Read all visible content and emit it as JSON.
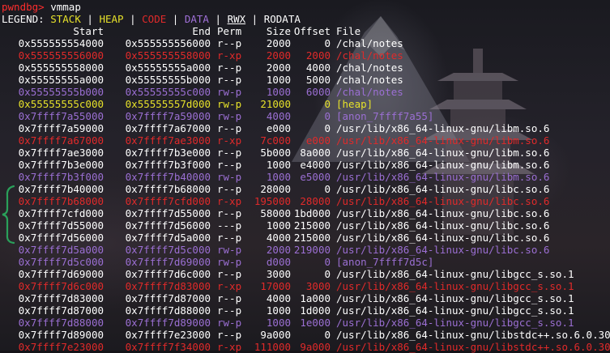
{
  "prompt": {
    "name": "pwndbg>",
    "command": "vmmap"
  },
  "legend": {
    "label": "LEGEND:",
    "stack": "STACK",
    "heap": "HEAP",
    "code": "CODE",
    "data": "DATA",
    "rwx": "RWX",
    "rodata": "RODATA",
    "separator": "|"
  },
  "colors": {
    "code": "#e02a2a",
    "heap_stack": "#e6e12a",
    "data": "#9b6fd3",
    "rodata": "#ffffff",
    "prompt": "#ff2d2d",
    "brace": "#2aa05a"
  },
  "table": {
    "headers": [
      "Start",
      "End",
      "Perm",
      "Size",
      "Offset",
      "File"
    ],
    "rows": [
      {
        "start": "0x555555554000",
        "end": "0x555555556000",
        "perm": "r--p",
        "size": "2000",
        "offset": "0",
        "file": "/chal/notes",
        "kind": "rodata"
      },
      {
        "start": "0x555555556000",
        "end": "0x555555558000",
        "perm": "r-xp",
        "size": "2000",
        "offset": "2000",
        "file": "/chal/notes",
        "kind": "code"
      },
      {
        "start": "0x555555558000",
        "end": "0x55555555a000",
        "perm": "r--p",
        "size": "2000",
        "offset": "4000",
        "file": "/chal/notes",
        "kind": "rodata"
      },
      {
        "start": "0x55555555a000",
        "end": "0x55555555b000",
        "perm": "r--p",
        "size": "1000",
        "offset": "5000",
        "file": "/chal/notes",
        "kind": "rodata"
      },
      {
        "start": "0x55555555b000",
        "end": "0x55555555c000",
        "perm": "rw-p",
        "size": "1000",
        "offset": "6000",
        "file": "/chal/notes",
        "kind": "data"
      },
      {
        "start": "0x55555555c000",
        "end": "0x55555557d000",
        "perm": "rw-p",
        "size": "21000",
        "offset": "0",
        "file": "[heap]",
        "kind": "heap"
      },
      {
        "start": "0x7ffff7a55000",
        "end": "0x7ffff7a59000",
        "perm": "rw-p",
        "size": "4000",
        "offset": "0",
        "file": "[anon_7ffff7a55]",
        "kind": "data"
      },
      {
        "start": "0x7ffff7a59000",
        "end": "0x7ffff7a67000",
        "perm": "r--p",
        "size": "e000",
        "offset": "0",
        "file": "/usr/lib/x86_64-linux-gnu/libm.so.6",
        "kind": "rodata"
      },
      {
        "start": "0x7ffff7a67000",
        "end": "0x7ffff7ae3000",
        "perm": "r-xp",
        "size": "7c000",
        "offset": "e000",
        "file": "/usr/lib/x86_64-linux-gnu/libm.so.6",
        "kind": "code"
      },
      {
        "start": "0x7ffff7ae3000",
        "end": "0x7ffff7b3e000",
        "perm": "r--p",
        "size": "5b000",
        "offset": "8a000",
        "file": "/usr/lib/x86_64-linux-gnu/libm.so.6",
        "kind": "rodata"
      },
      {
        "start": "0x7ffff7b3e000",
        "end": "0x7ffff7b3f000",
        "perm": "r--p",
        "size": "1000",
        "offset": "e4000",
        "file": "/usr/lib/x86_64-linux-gnu/libm.so.6",
        "kind": "rodata"
      },
      {
        "start": "0x7ffff7b3f000",
        "end": "0x7ffff7b40000",
        "perm": "rw-p",
        "size": "1000",
        "offset": "e5000",
        "file": "/usr/lib/x86_64-linux-gnu/libm.so.6",
        "kind": "data"
      },
      {
        "start": "0x7ffff7b40000",
        "end": "0x7ffff7b68000",
        "perm": "r--p",
        "size": "28000",
        "offset": "0",
        "file": "/usr/lib/x86_64-linux-gnu/libc.so.6",
        "kind": "rodata"
      },
      {
        "start": "0x7ffff7b68000",
        "end": "0x7ffff7cfd000",
        "perm": "r-xp",
        "size": "195000",
        "offset": "28000",
        "file": "/usr/lib/x86_64-linux-gnu/libc.so.6",
        "kind": "code"
      },
      {
        "start": "0x7ffff7cfd000",
        "end": "0x7ffff7d55000",
        "perm": "r--p",
        "size": "58000",
        "offset": "1bd000",
        "file": "/usr/lib/x86_64-linux-gnu/libc.so.6",
        "kind": "rodata"
      },
      {
        "start": "0x7ffff7d55000",
        "end": "0x7ffff7d56000",
        "perm": "---p",
        "size": "1000",
        "offset": "215000",
        "file": "/usr/lib/x86_64-linux-gnu/libc.so.6",
        "kind": "rodata"
      },
      {
        "start": "0x7ffff7d56000",
        "end": "0x7ffff7d5a000",
        "perm": "r--p",
        "size": "4000",
        "offset": "215000",
        "file": "/usr/lib/x86_64-linux-gnu/libc.so.6",
        "kind": "rodata"
      },
      {
        "start": "0x7ffff7d5a000",
        "end": "0x7ffff7d5c000",
        "perm": "rw-p",
        "size": "2000",
        "offset": "219000",
        "file": "/usr/lib/x86_64-linux-gnu/libc.so.6",
        "kind": "data"
      },
      {
        "start": "0x7ffff7d5c000",
        "end": "0x7ffff7d69000",
        "perm": "rw-p",
        "size": "d000",
        "offset": "0",
        "file": "[anon_7ffff7d5c]",
        "kind": "data"
      },
      {
        "start": "0x7ffff7d69000",
        "end": "0x7ffff7d6c000",
        "perm": "r--p",
        "size": "3000",
        "offset": "0",
        "file": "/usr/lib/x86_64-linux-gnu/libgcc_s.so.1",
        "kind": "rodata"
      },
      {
        "start": "0x7ffff7d6c000",
        "end": "0x7ffff7d83000",
        "perm": "r-xp",
        "size": "17000",
        "offset": "3000",
        "file": "/usr/lib/x86_64-linux-gnu/libgcc_s.so.1",
        "kind": "code"
      },
      {
        "start": "0x7ffff7d83000",
        "end": "0x7ffff7d87000",
        "perm": "r--p",
        "size": "4000",
        "offset": "1a000",
        "file": "/usr/lib/x86_64-linux-gnu/libgcc_s.so.1",
        "kind": "rodata"
      },
      {
        "start": "0x7ffff7d87000",
        "end": "0x7ffff7d88000",
        "perm": "r--p",
        "size": "1000",
        "offset": "1d000",
        "file": "/usr/lib/x86_64-linux-gnu/libgcc_s.so.1",
        "kind": "rodata"
      },
      {
        "start": "0x7ffff7d88000",
        "end": "0x7ffff7d89000",
        "perm": "rw-p",
        "size": "1000",
        "offset": "1e000",
        "file": "/usr/lib/x86_64-linux-gnu/libgcc_s.so.1",
        "kind": "data"
      },
      {
        "start": "0x7ffff7d89000",
        "end": "0x7ffff7e23000",
        "perm": "r--p",
        "size": "9a000",
        "offset": "0",
        "file": "/usr/lib/x86_64-linux-gnu/libstdc++.so.6.0.30",
        "kind": "rodata"
      },
      {
        "start": "0x7ffff7e23000",
        "end": "0x7ffff7f34000",
        "perm": "r-xp",
        "size": "111000",
        "offset": "9a000",
        "file": "/usr/lib/x86_64-linux-gnu/libstdc++.so.6.0.30",
        "kind": "code"
      }
    ]
  }
}
